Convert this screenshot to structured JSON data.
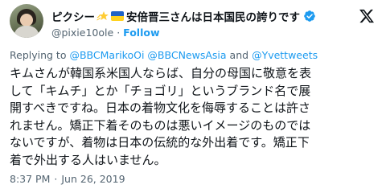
{
  "author": {
    "display_name": "ピクシー",
    "display_name_suffix": "安倍晋三さんは日本国民の誇りです",
    "handle": "@pixie10ole",
    "separator": "·",
    "follow_label": "Follow",
    "flag_colors": [
      "#1f63c6",
      "#ffd21f"
    ],
    "verified_color": "#1d9bf0",
    "icons": [
      "star-emoji-icon",
      "ukraine-flag-icon",
      "verified-badge-icon",
      "x-logo-icon"
    ]
  },
  "replying": {
    "prefix": "Replying to",
    "users": [
      "@BBCMarikoOi",
      "@BBCNewsAsia"
    ],
    "conjunction": "and",
    "last_user": "@Yvettweets"
  },
  "tweet": {
    "lines": [
      "キムさんが韓国系米国人ならば、自分の母国に敬意を表",
      "して「キムチ」とか「チョゴリ」というブランド名で展",
      "開すべきですね。日本の着物文化を侮辱することは許さ",
      "れません。矯正下着そのものは悪いイメージのものでは",
      "ないですが、着物は日本の伝統的な外出着です。矯正下",
      "着で外出する人はいません。"
    ]
  },
  "meta": {
    "time": "8:37 PM",
    "separator": "·",
    "date": "Jun 26, 2019"
  },
  "colors": {
    "link": "#1d9bf0",
    "secondary_text": "#536471",
    "primary_text": "#0f1419"
  }
}
